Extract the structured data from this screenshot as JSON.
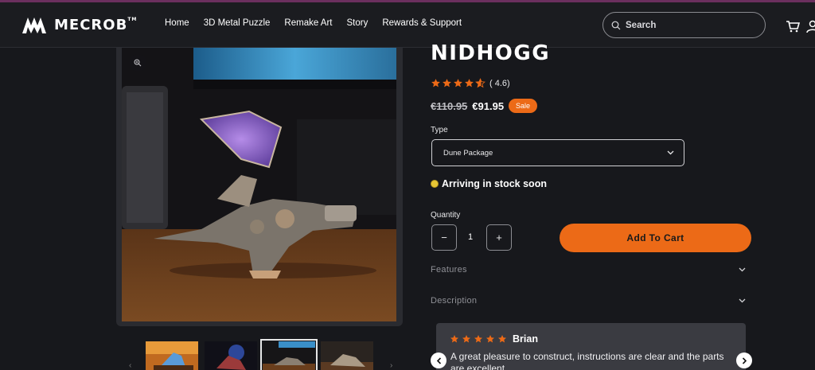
{
  "brand": {
    "name": "MECROB",
    "mark": "TM"
  },
  "nav": [
    {
      "label": "Home"
    },
    {
      "label": "3D Metal Puzzle"
    },
    {
      "label": "Remake Art"
    },
    {
      "label": "Story"
    },
    {
      "label": "Rewards & Support"
    }
  ],
  "search": {
    "placeholder": "Search",
    "icon": "search-icon"
  },
  "header_icons": [
    "cart-icon",
    "user-icon"
  ],
  "gallery": {
    "zoom_icon": "zoom-icon",
    "thumbnail_count": 4,
    "active_thumbnail": 3
  },
  "product": {
    "title": "NIDHOGG",
    "rating_value": 4.6,
    "rating_text": "( 4.6)",
    "old_price": "€110.95",
    "new_price": "€91.95",
    "sale_label": "Sale",
    "type_label": "Type",
    "type_value": "Dune Package",
    "stock_text": "Arriving in stock soon",
    "quantity_label": "Quantity",
    "quantity": "1",
    "minus_label": "−",
    "plus_label": "+",
    "add_to_cart": "Add To Cart",
    "accordions": [
      {
        "label": "Features"
      },
      {
        "label": "Description"
      }
    ]
  },
  "review": {
    "stars": 5,
    "name": "Brian",
    "text": "A great pleasure to construct, instructions are clear and the parts are excellent"
  },
  "colors": {
    "accent": "#ec6a17",
    "star": "#ec6a17",
    "stock_dot": "#e6c535",
    "background": "#17181c"
  }
}
